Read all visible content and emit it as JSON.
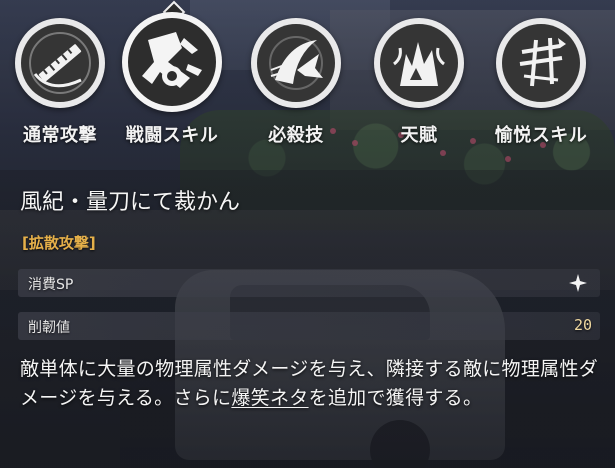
{
  "tabs": [
    {
      "label": "通常攻撃",
      "icon": "basic-attack-icon",
      "selected": false
    },
    {
      "label": "戦闘スキル",
      "icon": "skill-icon",
      "selected": true
    },
    {
      "label": "必殺技",
      "icon": "ultimate-icon",
      "selected": false
    },
    {
      "label": "天賦",
      "icon": "talent-icon",
      "selected": false
    },
    {
      "label": "愉悦スキル",
      "icon": "elation-skill-icon",
      "selected": false
    }
  ],
  "detail": {
    "skill_name": "風紀・量刀にて裁かん",
    "skill_type": "[拡散攻撃]",
    "sp_label": "消費SP",
    "sp_icon": "sparkle-icon",
    "toughness_label": "削韌値",
    "toughness_value": "20",
    "description_part1": "敵単体に大量の物理属性ダメージを与え、隣接する敵に物理属性ダメージを与える。さらに",
    "description_keyword": "爆笑ネタ",
    "description_part2": "を追加で獲得する。"
  },
  "colors": {
    "skill_type": "#e5b04a",
    "value_text": "#f0d9a0",
    "tab_ring": "#e9e9ea",
    "tab_disc": "#353535"
  }
}
